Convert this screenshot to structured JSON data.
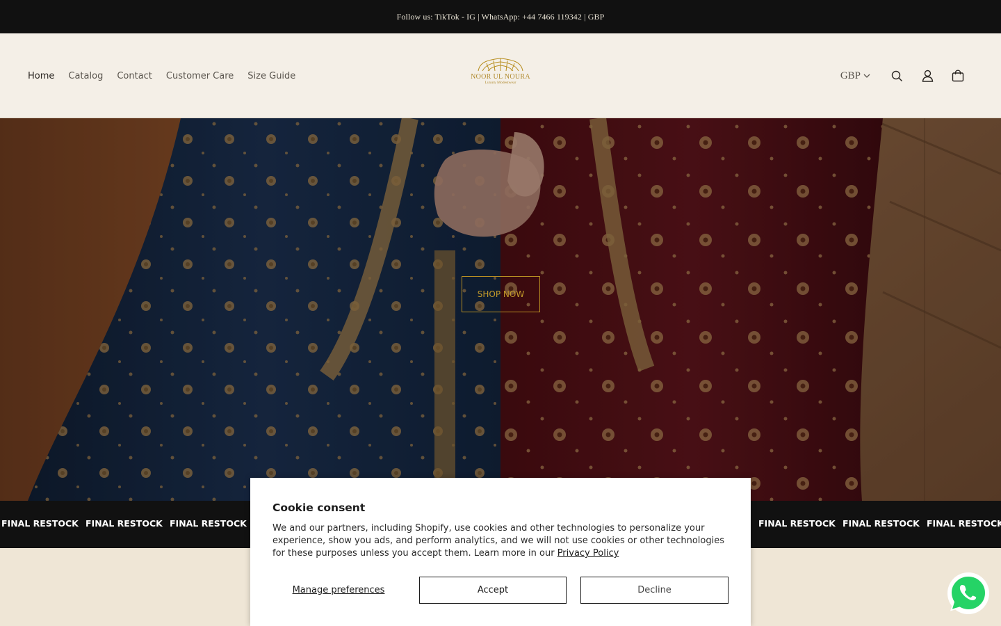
{
  "announcement": {
    "text": "Follow us: TikTok - IG | WhatsApp: +44 7466 119342 | GBP"
  },
  "nav": {
    "items": [
      {
        "label": "Home"
      },
      {
        "label": "Catalog"
      },
      {
        "label": "Contact"
      },
      {
        "label": "Customer Care"
      },
      {
        "label": "Size Guide"
      }
    ]
  },
  "logo": {
    "name": "NOOR UL NOURA",
    "tagline": "Luxury Modestwear"
  },
  "header_tools": {
    "currency": "GBP",
    "icons": [
      "search-icon",
      "account-icon",
      "cart-icon"
    ]
  },
  "hero": {
    "button_label": "SHOP NOW"
  },
  "marquee": {
    "text": "FINAL RESTOCK"
  },
  "cookie": {
    "title": "Cookie consent",
    "body": "We and our partners, including Shopify, use cookies and other technologies to personalize your experience, show you ads, and perform analytics, and we will not use cookies or other technologies for these purposes unless you accept them. Learn more in our ",
    "link": "Privacy Policy",
    "manage_label": "Manage preferences",
    "accept_label": "Accept",
    "decline_label": "Decline"
  },
  "colors": {
    "announcement_bg": "#111111",
    "header_bg": "#f4efe7",
    "gold": "#b88f22",
    "page_bg": "#efe6d6",
    "whatsapp": "#25d366"
  }
}
